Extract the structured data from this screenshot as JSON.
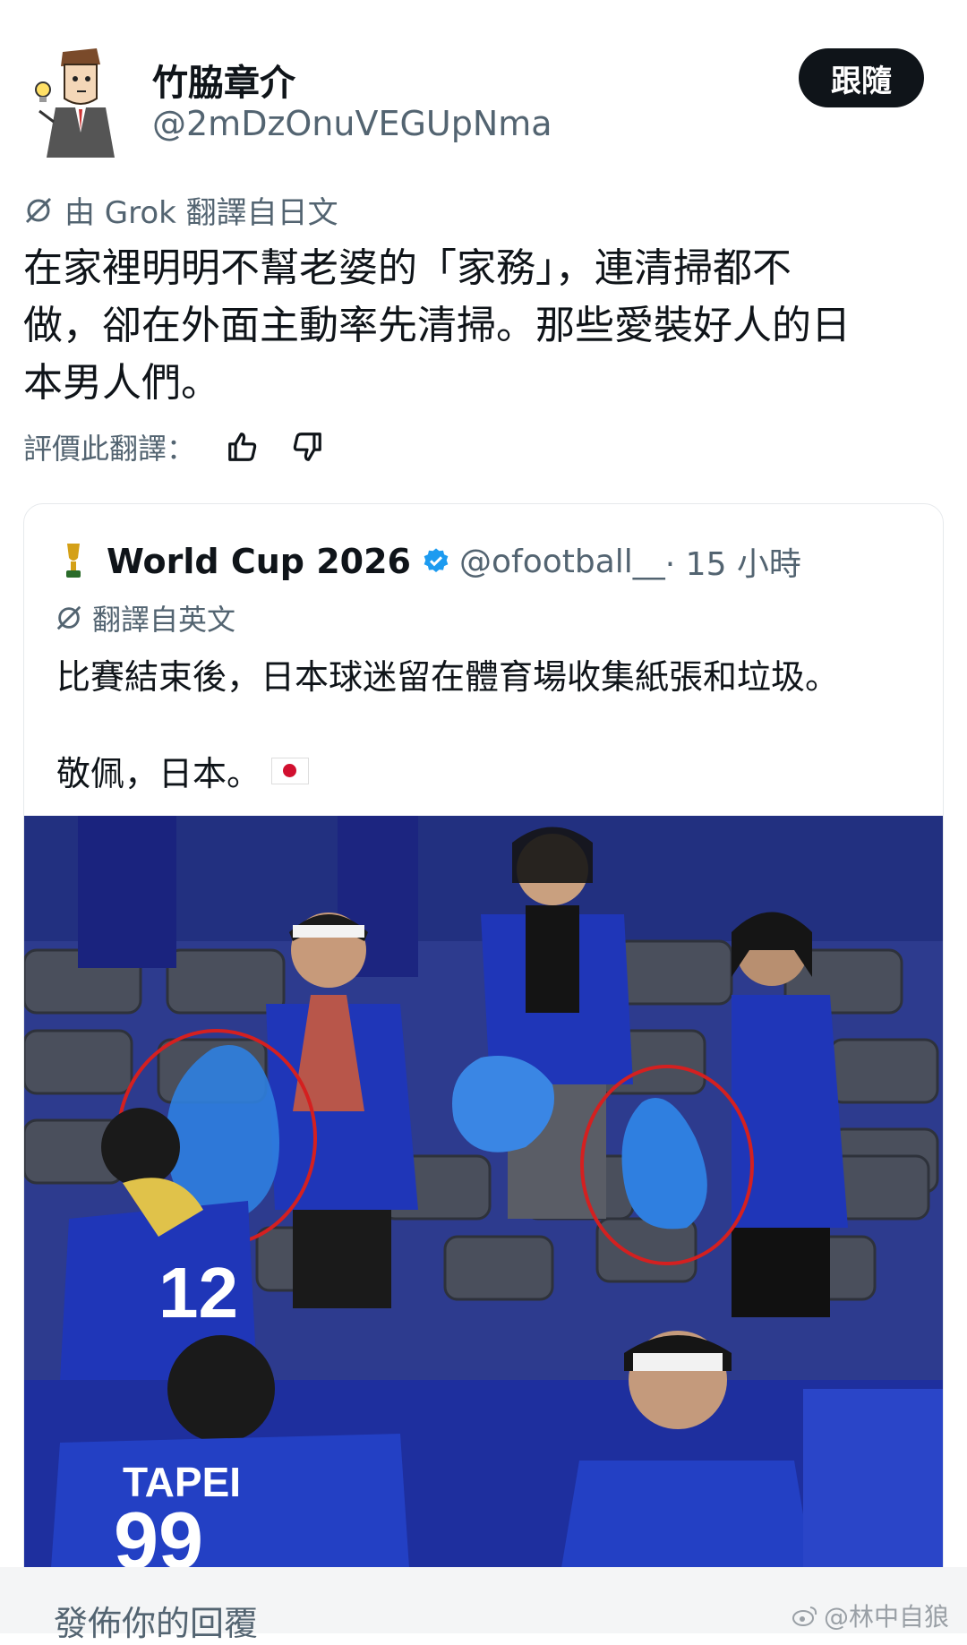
{
  "author": {
    "display_name": "竹脇章介",
    "handle": "@2mDzOnuVEGUpNma",
    "follow_label": "跟隨"
  },
  "translation": {
    "notice": "由 Grok 翻譯自日文",
    "lines": [
      "在家裡明明不幫老婆的「家務」，連清掃都不",
      "做，卻在外面主動率先清掃。那些愛裝好人的日",
      "本男人們。"
    ],
    "rate_label": "評價此翻譯："
  },
  "quoted_post": {
    "name": "World Cup 2026",
    "handle": "@ofootball__",
    "time": "· 15 小時",
    "translate_notice": "翻譯自英文",
    "text_line1": "比賽結束後，日本球迷留在體育場收集紙張和垃圾。",
    "text_line2": "敬佩，日本。",
    "photo_texts": {
      "jersey_number": "12",
      "taipei_jersey": "TAPEI",
      "taipei_number": "99"
    }
  },
  "reply": {
    "placeholder": "發佈你的回覆"
  },
  "watermark": {
    "text": "@林中自狼"
  },
  "colors": {
    "text_primary": "#0f1419",
    "text_secondary": "#536471",
    "verified": "#1d9bf0",
    "jersey_blue": "#1f36b8",
    "circle_red": "#d42020"
  },
  "icons": [
    "translate-icon",
    "thumbs-up-icon",
    "thumbs-down-icon",
    "trophy-icon",
    "verified-badge-icon",
    "japan-flag-icon",
    "weibo-icon"
  ]
}
